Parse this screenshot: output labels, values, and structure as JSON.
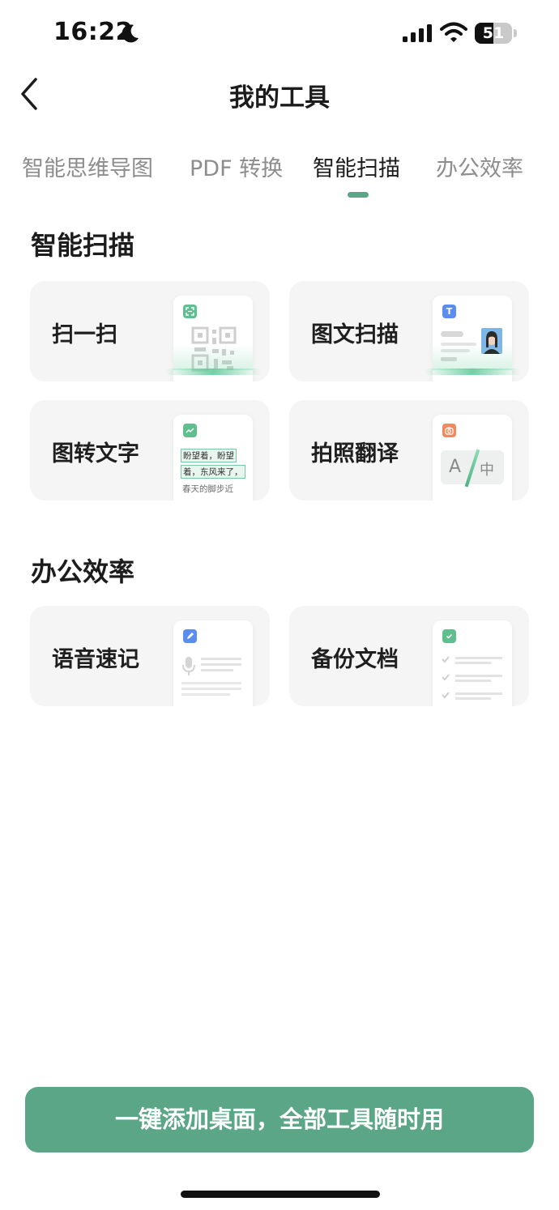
{
  "status_bar": {
    "time": "16:22",
    "battery": "51",
    "battery_level": 0.51
  },
  "header": {
    "title": "我的工具"
  },
  "tabs": [
    {
      "label": "智能思维导图",
      "active": false
    },
    {
      "label": "PDF 转换",
      "active": false
    },
    {
      "label": "智能扫描",
      "active": true
    },
    {
      "label": "办公效率",
      "active": false
    }
  ],
  "sections": [
    {
      "title": "智能扫描",
      "cards": [
        {
          "label": "扫一扫",
          "icon": "qr-scan-icon"
        },
        {
          "label": "图文扫描",
          "icon": "document-scan-icon"
        },
        {
          "label": "图转文字",
          "icon": "image-to-text-icon",
          "preview_lines": [
            "盼望着，盼望",
            "着，东风来了，",
            "春天的脚步近"
          ]
        },
        {
          "label": "拍照翻译",
          "icon": "camera-translate-icon",
          "preview_source": "A",
          "preview_target": "中"
        }
      ]
    },
    {
      "title": "办公效率",
      "cards": [
        {
          "label": "语音速记",
          "icon": "voice-note-icon"
        },
        {
          "label": "备份文档",
          "icon": "backup-doc-icon"
        }
      ]
    }
  ],
  "cta": {
    "label": "一键添加桌面，全部工具随时用"
  },
  "colors": {
    "accent": "#5aa686",
    "card_bg": "#f4f5f4",
    "inactive_tab": "#8d8d8d"
  }
}
